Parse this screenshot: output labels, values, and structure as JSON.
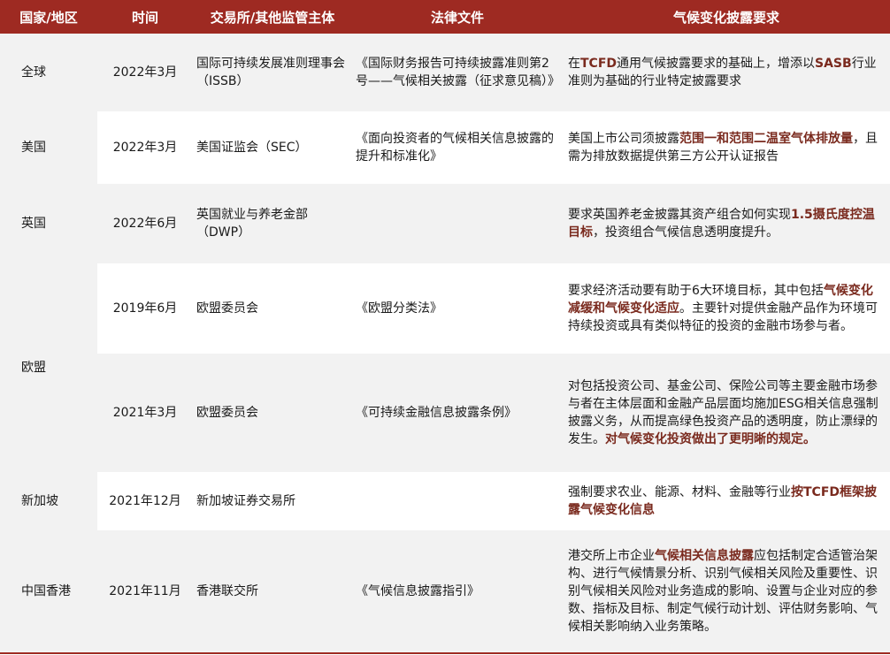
{
  "headers": [
    "国家/地区",
    "时间",
    "交易所/其他监管主体",
    "法律文件",
    "气候变化披露要求"
  ],
  "rows": [
    {
      "region": "全球",
      "time": "2022年3月",
      "org": "国际可持续发展准则理事会（ISSB）",
      "law": "《国际财务报告可持续披露准则第2号——气候相关披露（征求意见稿）》",
      "req": [
        {
          "t": "在",
          "b": false
        },
        {
          "t": "TCFD",
          "b": true
        },
        {
          "t": "通用气候披露要求的基础上，增添以",
          "b": false
        },
        {
          "t": "SASB",
          "b": true
        },
        {
          "t": "行业准则为基础的行业特定披露要求",
          "b": false
        }
      ]
    },
    {
      "region": "美国",
      "time": "2022年3月",
      "org": "美国证监会（SEC）",
      "law": "《面向投资者的气候相关信息披露的提升和标准化》",
      "req": [
        {
          "t": "美国上市公司须披露",
          "b": false
        },
        {
          "t": "范围一和范围二温室气体排放量",
          "b": true
        },
        {
          "t": "，且需为排放数据提供第三方公开认证报告",
          "b": false
        }
      ]
    },
    {
      "region": "英国",
      "time": "2022年6月",
      "org": "英国就业与养老金部（DWP）",
      "law": "",
      "req": [
        {
          "t": "要求英国养老金披露其资产组合如何实现",
          "b": false
        },
        {
          "t": "1.5摄氏度控温目标",
          "b": true
        },
        {
          "t": "，投资组合气候信息透明度提升。",
          "b": false
        }
      ]
    },
    {
      "region": "欧盟",
      "time": "2019年6月",
      "org": "欧盟委员会",
      "law": "《欧盟分类法》",
      "req": [
        {
          "t": "要求经济活动要有助于6大环境目标，其中包括",
          "b": false
        },
        {
          "t": "气候变化减缓和气候变化适应",
          "b": true
        },
        {
          "t": "。主要针对提供金融产品作为环境可持续投资或具有类似特征的投资的金融市场参与者。",
          "b": false
        }
      ]
    },
    {
      "region": "",
      "time": "2021年3月",
      "org": "欧盟委员会",
      "law": "《可持续金融信息披露条例》",
      "req": [
        {
          "t": "对包括投资公司、基金公司、保险公司等主要金融市场参与者在主体层面和金融产品层面均施加ESG相关信息强制披露义务，从而提高绿色投资产品的透明度，防止漂绿的发生。",
          "b": false
        },
        {
          "t": "对气候变化投资做出了更明晰的规定。",
          "b": true
        }
      ]
    },
    {
      "region": "新加坡",
      "time": "2021年12月",
      "org": "新加坡证券交易所",
      "law": "",
      "req": [
        {
          "t": "强制要求农业、能源、材料、金融等行业",
          "b": false
        },
        {
          "t": "按TCFD框架披露气候变化信息",
          "b": true
        }
      ]
    },
    {
      "region": "中国香港",
      "time": "2021年11月",
      "org": "香港联交所",
      "law": "《气候信息披露指引》",
      "req": [
        {
          "t": "港交所上市企业",
          "b": false
        },
        {
          "t": "气候相关信息披露",
          "b": true
        },
        {
          "t": "应包括制定合适管治架构、进行气候情景分析、识别气候相关风险及重要性、识别气候相关风险对业务造成的影响、设置与企业对应的参数、指标及目标、制定气候行动计划、评估财务影响、气候相关影响纳入业务策略。",
          "b": false
        }
      ]
    }
  ]
}
